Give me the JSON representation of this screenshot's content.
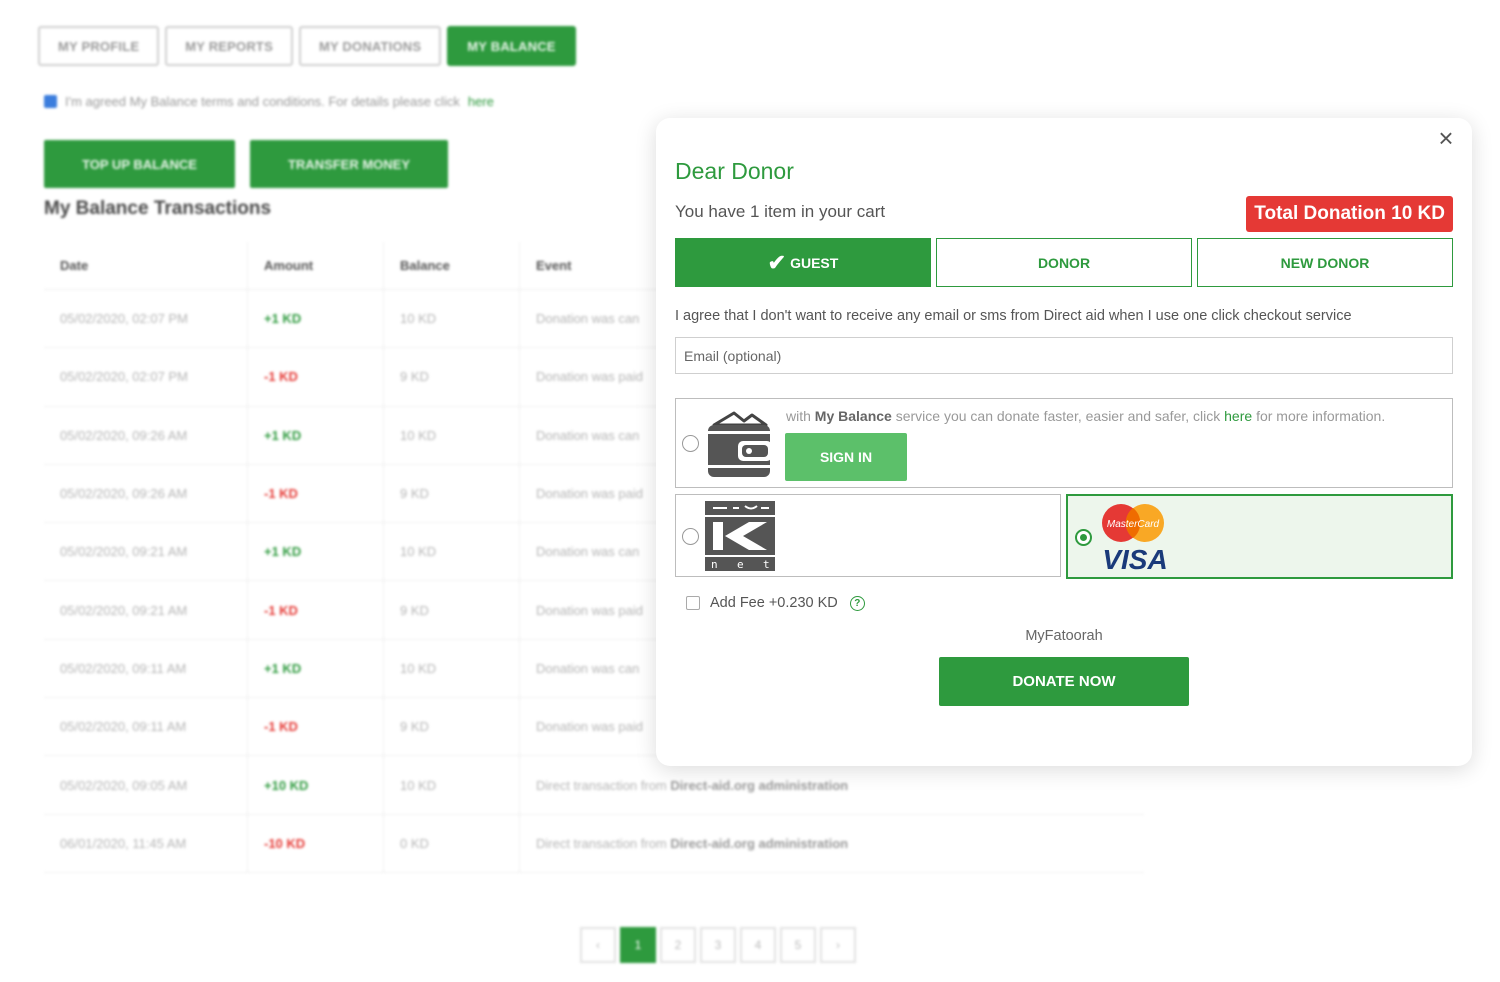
{
  "tabs": [
    "MY PROFILE",
    "MY REPORTS",
    "MY DONATIONS",
    "MY BALANCE"
  ],
  "agreement": {
    "text": "I'm agreed My Balance terms and conditions. For details please click",
    "link": "here"
  },
  "actions": {
    "top_up": "TOP UP BALANCE",
    "transfer": "TRANSFER MONEY"
  },
  "transactions": {
    "title": "My Balance Transactions",
    "headers": [
      "Date",
      "Amount",
      "Balance",
      "Event"
    ],
    "rows": [
      {
        "date": "05/02/2020, 02:07 PM",
        "amount": "+1 KD",
        "balance": "10 KD",
        "event": "Donation was can"
      },
      {
        "date": "05/02/2020, 02:07 PM",
        "amount": "-1 KD",
        "balance": "9 KD",
        "event": "Donation was paid"
      },
      {
        "date": "05/02/2020, 09:26 AM",
        "amount": "+1 KD",
        "balance": "10 KD",
        "event": "Donation was can"
      },
      {
        "date": "05/02/2020, 09:26 AM",
        "amount": "-1 KD",
        "balance": "9 KD",
        "event": "Donation was paid"
      },
      {
        "date": "05/02/2020, 09:21 AM",
        "amount": "+1 KD",
        "balance": "10 KD",
        "event": "Donation was can"
      },
      {
        "date": "05/02/2020, 09:21 AM",
        "amount": "-1 KD",
        "balance": "9 KD",
        "event": "Donation was paid"
      },
      {
        "date": "05/02/2020, 09:11 AM",
        "amount": "+1 KD",
        "balance": "10 KD",
        "event": "Donation was can"
      },
      {
        "date": "05/02/2020, 09:11 AM",
        "amount": "-1 KD",
        "balance": "9 KD",
        "event": "Donation was paid"
      },
      {
        "date": "05/02/2020, 09:05 AM",
        "amount": "+10 KD",
        "balance": "10 KD",
        "event": "Direct transaction from",
        "event_bold": "Direct-aid.org administration"
      },
      {
        "date": "06/01/2020, 11:45 AM",
        "amount": "-10 KD",
        "balance": "0 KD",
        "event": "Direct transaction from",
        "event_bold": "Direct-aid.org administration"
      }
    ]
  },
  "pagination": {
    "prev": "‹",
    "pages": [
      "1",
      "2",
      "3",
      "4",
      "5"
    ],
    "next": "›",
    "current": "1"
  },
  "modal": {
    "title": "Dear Donor",
    "subtitle": "You have 1 item in your cart",
    "total": "Total Donation 10 KD",
    "donor_types": [
      "GUEST",
      "DONOR",
      "NEW DONOR"
    ],
    "selected_type": "GUEST",
    "consent": "I agree that I don't want to receive any email or sms from Direct aid when I use one click checkout service",
    "email_placeholder": "Email (optional)",
    "balance_info": {
      "prefix": "with",
      "brand": "My Balance",
      "middle": "service you can donate faster, easier and safer, click",
      "link": "here",
      "suffix": "for more information."
    },
    "sign_in": "SIGN IN",
    "knet_letters": [
      "n",
      "e",
      "t"
    ],
    "visa_logo": {
      "mastercard": "MasterCard",
      "visa": "VISA"
    },
    "selected_method": "visa-mastercard",
    "fee_label": "Add Fee +0.230 KD",
    "fee_help": "?",
    "provider": "MyFatoorah",
    "donate": "DONATE NOW",
    "close": "×"
  },
  "colors": {
    "brand_green": "#2e9a3e",
    "light_green": "#5cc06a",
    "red": "#e53935"
  }
}
